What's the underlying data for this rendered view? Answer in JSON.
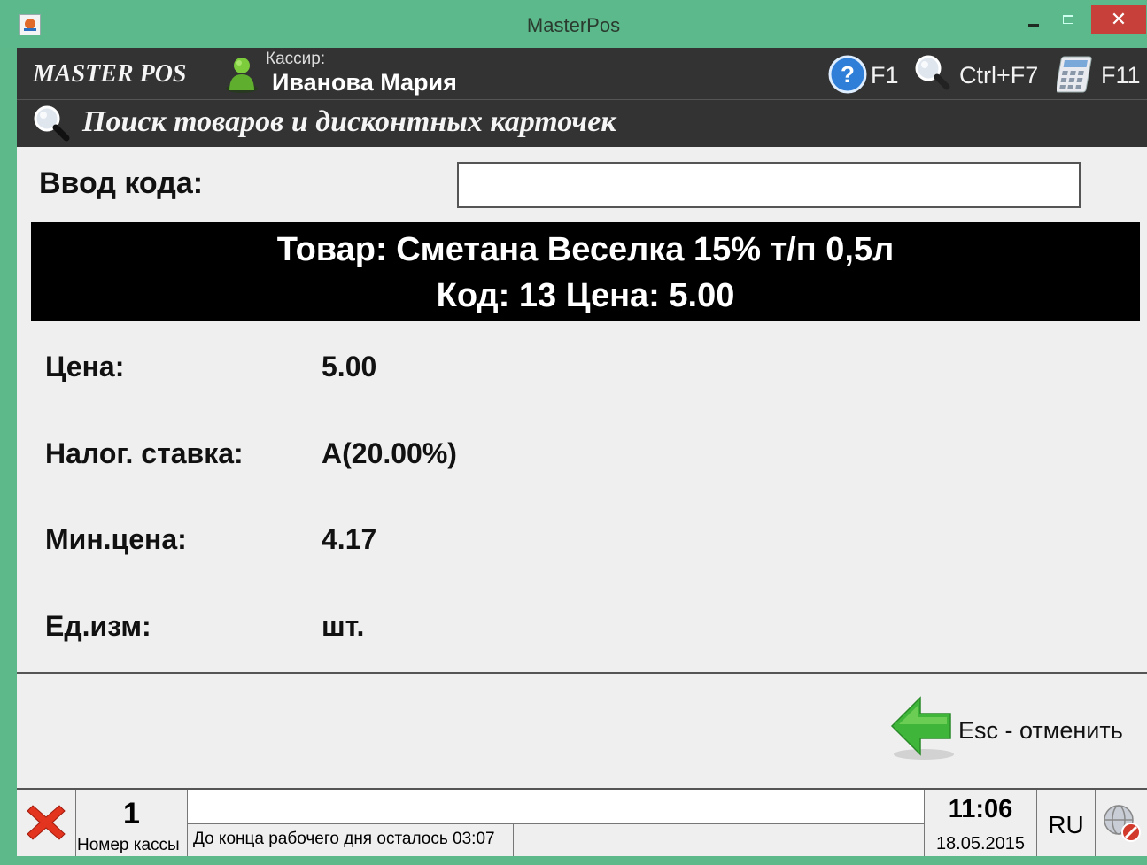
{
  "window": {
    "title": "MasterPos",
    "close_glyph": "✕"
  },
  "header": {
    "logo": "MASTER POS",
    "cashier_label": "Кассир:",
    "cashier_name": "Иванова Мария",
    "hotkeys": [
      {
        "icon": "help-icon",
        "label": "F1"
      },
      {
        "icon": "search-icon",
        "label": "Ctrl+F7"
      },
      {
        "icon": "calculator-icon",
        "label": "F11"
      }
    ]
  },
  "search_bar": {
    "title": "Поиск товаров и дисконтных карточек"
  },
  "code_entry": {
    "label": "Ввод кода:",
    "value": ""
  },
  "product": {
    "line1": "Товар: Сметана Веселка 15% т/п 0,5л",
    "line2": "Код: 13 Цена: 5.00"
  },
  "properties": [
    {
      "label": "Цена:",
      "value": "5.00"
    },
    {
      "label": "Налог. ставка:",
      "value": "A(20.00%)"
    },
    {
      "label": "Мин.цена:",
      "value": "4.17"
    },
    {
      "label": "Ед.изм:",
      "value": "шт."
    }
  ],
  "actions": {
    "cancel_label": "Esc - отменить"
  },
  "status_bar": {
    "register_number": "1",
    "register_label": "Номер кассы",
    "message": "До конца рабочего дня осталось 03:07",
    "time": "11:06",
    "date": "18.05.2015",
    "language": "RU"
  },
  "colors": {
    "window_frame": "#5cb98c",
    "header_bg": "#333333",
    "banner_bg": "#000000",
    "close_button": "#c7403a"
  }
}
